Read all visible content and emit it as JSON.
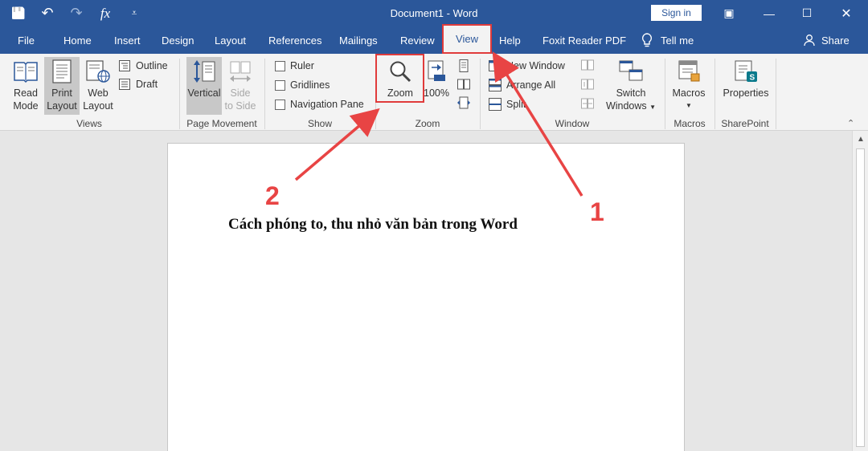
{
  "window": {
    "title": "Document1 - Word",
    "sign_in": "Sign in",
    "quick_access": {
      "save": "💾",
      "undo": "↶",
      "redo": "↷",
      "fx": "fx",
      "more": "⩡"
    },
    "controls": {
      "ribbon_display": "▣",
      "minimize": "—",
      "maximize": "☐",
      "close": "✕"
    }
  },
  "tabs": [
    {
      "label": "File"
    },
    {
      "label": "Home"
    },
    {
      "label": "Insert"
    },
    {
      "label": "Design"
    },
    {
      "label": "Layout"
    },
    {
      "label": "References"
    },
    {
      "label": "Mailings"
    },
    {
      "label": "Review"
    },
    {
      "label": "View"
    },
    {
      "label": "Help"
    },
    {
      "label": "Foxit Reader PDF"
    },
    {
      "label": "Tell me"
    },
    {
      "label": "Share"
    }
  ],
  "ribbon": {
    "views": {
      "label": "Views",
      "read_mode": [
        "Read",
        "Mode"
      ],
      "print_layout": [
        "Print",
        "Layout"
      ],
      "web_layout": [
        "Web",
        "Layout"
      ],
      "outline": "Outline",
      "draft": "Draft"
    },
    "page_movement": {
      "label": "Page Movement",
      "vertical": "Vertical",
      "side_to_side": [
        "Side",
        "to Side"
      ]
    },
    "show": {
      "label": "Show",
      "ruler": "Ruler",
      "gridlines": "Gridlines",
      "navigation_pane": "Navigation Pane"
    },
    "zoom": {
      "label": "Zoom",
      "zoom": "Zoom",
      "hundred": "100%"
    },
    "window": {
      "label": "Window",
      "new_window": "New Window",
      "arrange_all": "Arrange All",
      "split": "Split",
      "switch_windows": [
        "Switch",
        "Windows"
      ]
    },
    "macros": {
      "label": "Macros",
      "macros": "Macros"
    },
    "sharepoint": {
      "label": "SharePoint",
      "properties": "Properties"
    }
  },
  "document": {
    "text": "Cách phóng to, thu nhỏ văn bản trong Word"
  },
  "annotations": {
    "one": "1",
    "two": "2",
    "color": "#e84444"
  },
  "colors": {
    "brand": "#2b579a",
    "highlight": "#e03b3b"
  }
}
